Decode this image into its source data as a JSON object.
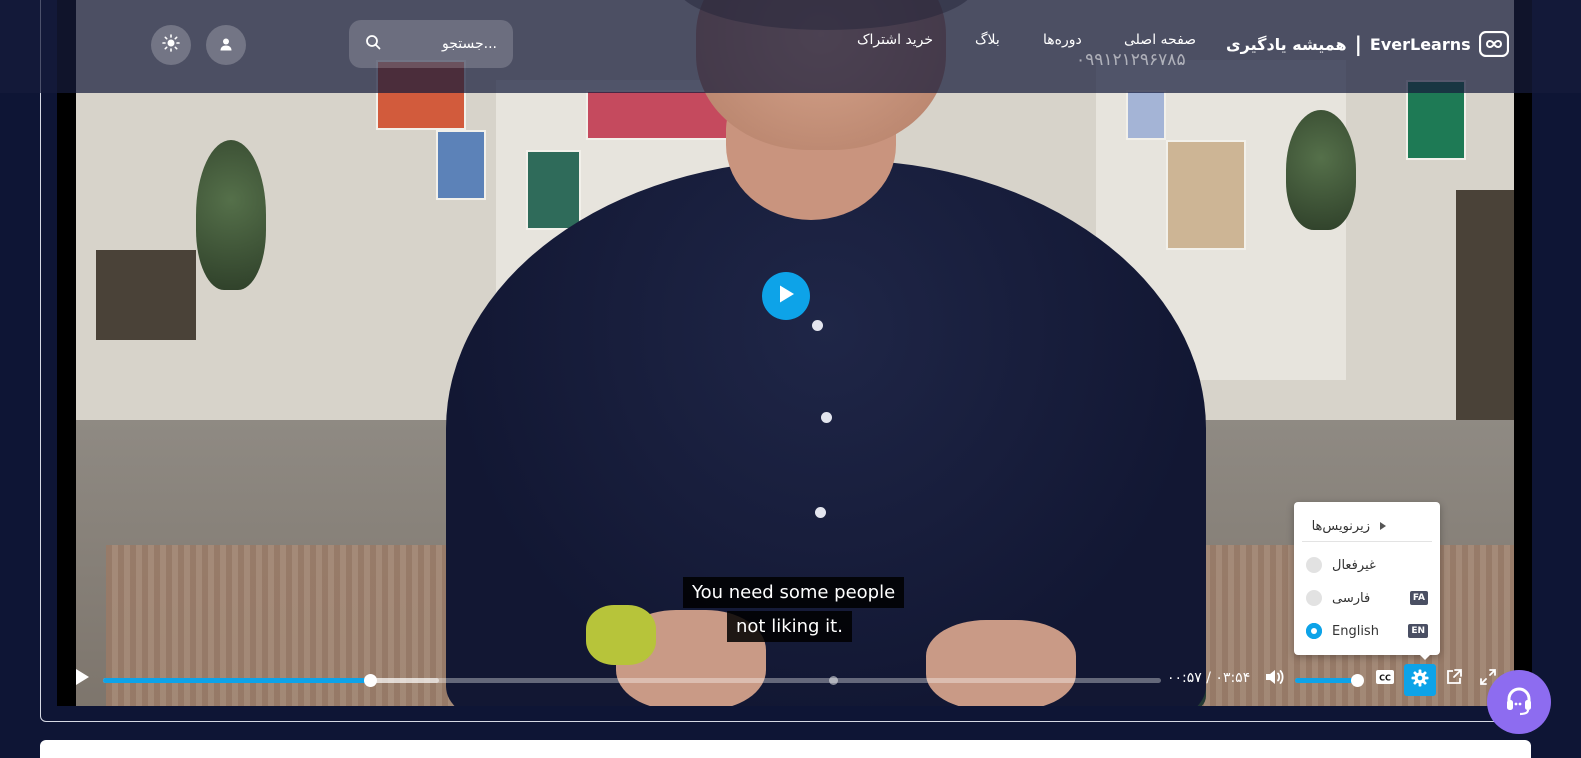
{
  "brand": {
    "name": "EverLearns",
    "separator": "|",
    "tagline": "همیشه یادگیری"
  },
  "nav": {
    "home": "صفحه اصلی",
    "courses": "دوره‌ها",
    "blog": "بلاگ",
    "subscribe": "خرید اشتراک"
  },
  "phone": "۰۹۹۱۲۱۲۹۶۷۸۵",
  "search": {
    "placeholder": "جستجو..."
  },
  "header_icons": {
    "user": "user-icon",
    "theme": "sun-icon",
    "search": "search-icon"
  },
  "video": {
    "subtitle_line1": "You need some people",
    "subtitle_line2": "not liking it.",
    "progress_fraction": 0.252,
    "buffered_fraction": 0.318,
    "chapter_marker_fraction": 0.69,
    "current_time": "۰۰:۵۷",
    "time_separator": "/",
    "duration": "۰۳:۵۴",
    "volume_fraction": 1.0
  },
  "captions_menu": {
    "title": "زیرنویس‌ها",
    "options": [
      {
        "label": "غیرفعال",
        "badge": "",
        "selected": false
      },
      {
        "label": "فارسی",
        "badge": "FA",
        "selected": false
      },
      {
        "label": "English",
        "badge": "EN",
        "selected": true
      }
    ]
  },
  "colors": {
    "accent": "#0da3e8",
    "background": "#0e1535",
    "support": "#8d6cf0"
  }
}
